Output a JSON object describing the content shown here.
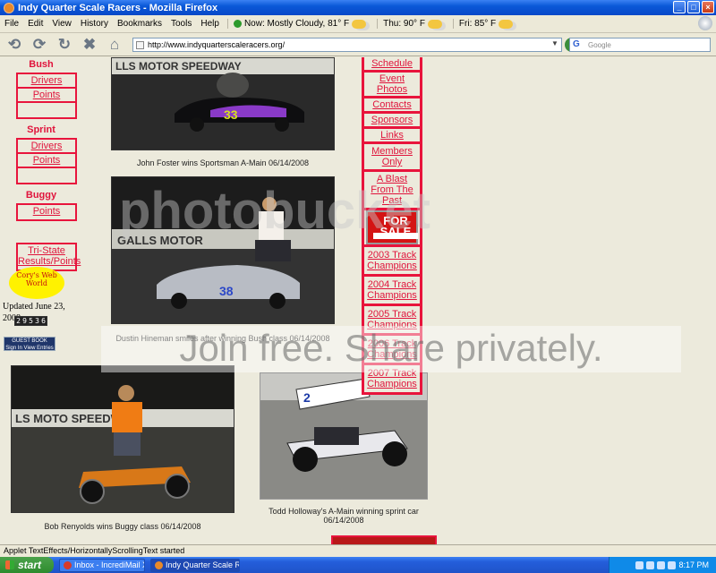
{
  "window": {
    "title": "Indy Quarter Scale Racers - Mozilla Firefox",
    "buttons": [
      "_",
      "□",
      "×"
    ]
  },
  "menubar": {
    "items": [
      "File",
      "Edit",
      "View",
      "History",
      "Bookmarks",
      "Tools",
      "Help"
    ],
    "weather": [
      {
        "label": "Now: Mostly Cloudy, 81° F"
      },
      {
        "label": "Thu: 90° F"
      },
      {
        "label": "Fri: 85° F"
      }
    ]
  },
  "navbar": {
    "url": "http://www.indyquarterscaleracers.org/",
    "search_placeholder": "Google",
    "buttons": [
      "back-icon",
      "forward-icon",
      "reload-icon",
      "stop-icon",
      "home-icon"
    ]
  },
  "leftnav": {
    "sections": [
      {
        "heading": "Bush",
        "links": [
          "Drivers",
          "Points",
          ""
        ]
      },
      {
        "heading": "Sprint",
        "links": [
          "Drivers",
          "Points",
          ""
        ]
      },
      {
        "heading": "Buggy",
        "links": [
          "Points"
        ]
      },
      {
        "heading": "",
        "links": [
          "Tri-State Results/Points"
        ]
      }
    ],
    "corys_web_world": "Cory's Web World",
    "updated": "Updated June 23, 2008",
    "counter": "29536",
    "guestbook": "GUEST BOOK",
    "guestbook_sub": "Sign In View Entries"
  },
  "rightnav": {
    "links": [
      "Schedule",
      "Event Photos",
      "Contacts",
      "Sponsors",
      "Links",
      "Members Only",
      "A Blast From The Past"
    ],
    "for_sale": "FOR SALE",
    "champions": [
      "2003 Track Champions",
      "2004 Track Champions",
      "2005 Track Champions",
      "2006 Track Champions",
      "2007 Track Champions"
    ]
  },
  "photos": [
    {
      "caption": "John Foster wins Sportsman A-Main 06/14/2008",
      "car_number": "33"
    },
    {
      "caption": "Dustin Hineman smiles after winning Bush class 06/14/2008",
      "car_number": "38"
    },
    {
      "caption": "Bob Renyolds wins Buggy class 06/14/2008",
      "car_number": ""
    },
    {
      "caption": "Todd Holloway's A-Main winning sprint car 06/14/2008",
      "car_number": "2"
    }
  ],
  "banner_text": [
    "LLS MOTOR SPEEDWAY",
    "GALLS MOTOR",
    "LS MOTO SPEEDWAY"
  ],
  "watermarks": {
    "primary": "Join free. Share privately.",
    "secondary": "photobucket"
  },
  "statusbar": {
    "text": "Applet TextEffects/HorizontallyScrollingText started"
  },
  "taskbar": {
    "start": "start",
    "tasks": [
      {
        "label": "Inbox - IncrediMail Xe"
      },
      {
        "label": "Indy Quarter Scale R..."
      }
    ],
    "clock": "8:17 PM"
  }
}
